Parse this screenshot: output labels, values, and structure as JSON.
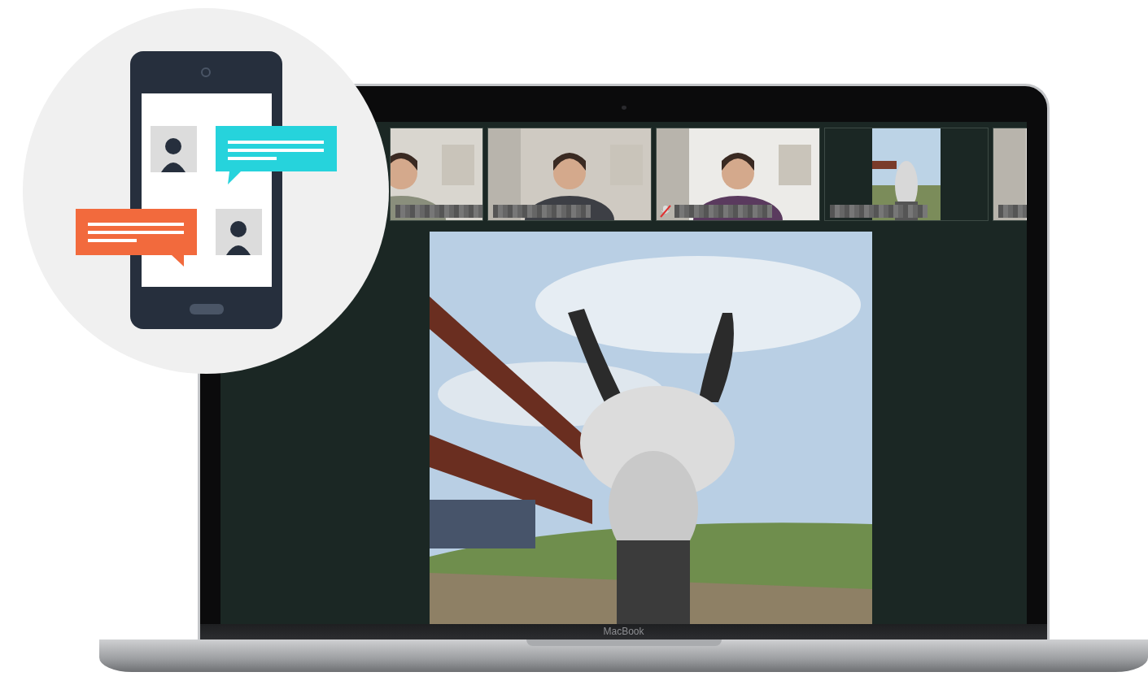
{
  "video_call": {
    "participants": [
      {
        "kind": "picture",
        "muted": false
      },
      {
        "kind": "picture",
        "muted": false
      },
      {
        "kind": "picture",
        "muted": true
      },
      {
        "kind": "picture",
        "muted": false
      },
      {
        "kind": "picture",
        "muted": false
      }
    ],
    "main_video": {
      "kind": "picture"
    }
  },
  "laptop": {
    "brand": "MacBook"
  }
}
